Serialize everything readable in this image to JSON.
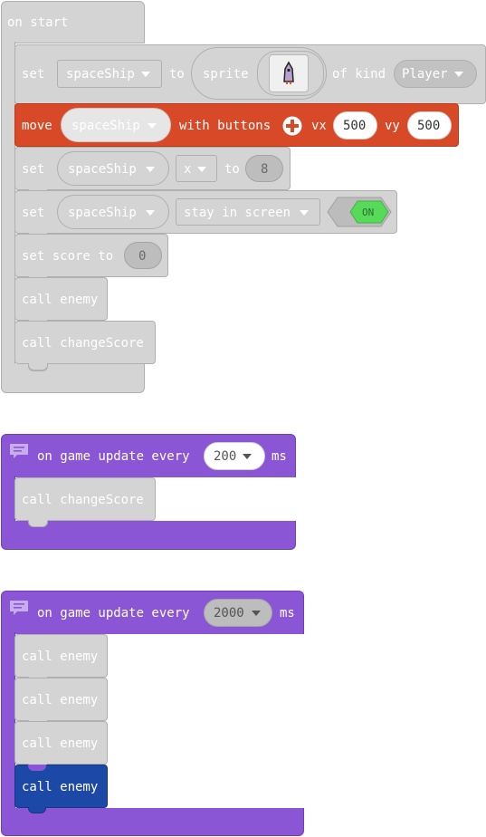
{
  "on_start": {
    "hat": "on start",
    "set1": {
      "set": "set",
      "var": "spaceShip",
      "to": "to",
      "sprite": "sprite",
      "of_kind": "of kind",
      "kind": "Player"
    },
    "move": {
      "move": "move",
      "var": "spaceShip",
      "with_buttons": "with buttons",
      "vx_label": "vx",
      "vx": "500",
      "vy_label": "vy",
      "vy": "500"
    },
    "set2": {
      "set": "set",
      "var": "spaceShip",
      "prop": "x",
      "to": "to",
      "value": "8"
    },
    "set3": {
      "set": "set",
      "var": "spaceShip",
      "prop": "stay in screen",
      "toggle": "ON"
    },
    "set_score": {
      "label": "set score to",
      "value": "0"
    },
    "call1": "call enemy",
    "call2": "call changeScore"
  },
  "update1": {
    "hat": "on game update every",
    "interval": "200",
    "ms": "ms",
    "call": "call changeScore"
  },
  "update2": {
    "hat": "on game update every",
    "interval": "2000",
    "ms": "ms",
    "calls": [
      "call enemy",
      "call enemy",
      "call enemy",
      "call enemy"
    ]
  },
  "colors": {
    "grey_block": "#d4d4d4",
    "orange_block": "#d84a27",
    "purple_block": "#8b56d6",
    "blue_block": "#1c48a8",
    "toggle_green": "#57d95a"
  },
  "icons": [
    "add-circle-icon",
    "comment-icon",
    "sprite-ship-icon",
    "dropdown-caret-icon"
  ]
}
